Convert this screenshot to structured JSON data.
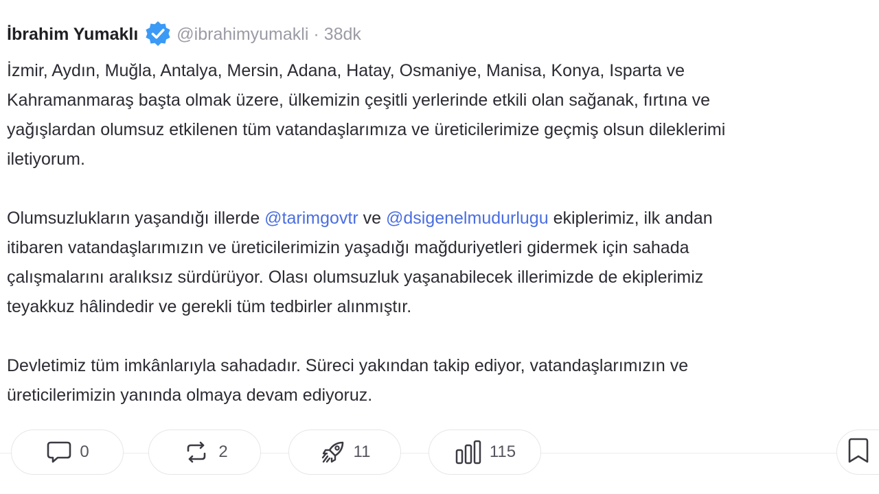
{
  "author": {
    "name": "İbrahim Yumaklı",
    "handle": "@ibrahimyumakli",
    "separator": "·",
    "time": "38dk",
    "verified_icon": "verified-badge-icon",
    "verified_color": "#3b9af5"
  },
  "post": {
    "paragraphs": [
      {
        "lines": [
          [
            {
              "text": "İzmir, Aydın, Muğla, Antalya, Mersin, Adana, Hatay, Osmaniye, Manisa, Konya, Isparta ve"
            }
          ],
          [
            {
              "text": "Kahramanmaraş başta olmak üzere, ülkemizin çeşitli yerlerinde etkili olan sağanak, fırtına ve"
            }
          ],
          [
            {
              "text": "yağışlardan olumsuz etkilenen tüm vatandaşlarımıza ve üreticilerimize geçmiş olsun dileklerimi"
            }
          ],
          [
            {
              "text": "iletiyorum."
            }
          ]
        ]
      },
      {
        "lines": [
          [
            {
              "text": "Olumsuzlukların yaşandığı illerde "
            },
            {
              "text": "@tarimgovtr",
              "mention": true
            },
            {
              "text": " ve "
            },
            {
              "text": "@dsigenelmudurlugu",
              "mention": true
            },
            {
              "text": " ekiplerimiz, ilk andan"
            }
          ],
          [
            {
              "text": "itibaren vatandaşlarımızın ve üreticilerimizin yaşadığı mağduriyetleri gidermek için sahada"
            }
          ],
          [
            {
              "text": "çalışmalarını aralıksız sürdürüyor. Olası olumsuzluk yaşanabilecek illerimizde de ekiplerimiz"
            }
          ],
          [
            {
              "text": "teyakkuz hâlindedir ve gerekli tüm tedbirler alınmıştır."
            }
          ]
        ]
      },
      {
        "lines": [
          [
            {
              "text": "Devletimiz tüm imkânlarıyla sahadadır. Süreci yakından takip ediyor, vatandaşlarımızın ve"
            }
          ],
          [
            {
              "text": "üreticilerimizin yanında olmaya devam ediyoruz."
            }
          ]
        ]
      }
    ],
    "mention_color": "#4a6ee0"
  },
  "actions": {
    "reply": {
      "icon": "reply-icon",
      "count": "0"
    },
    "repost": {
      "icon": "repost-icon",
      "count": "2"
    },
    "boost": {
      "icon": "rocket-icon",
      "count": "11"
    },
    "views": {
      "icon": "bar-chart-icon",
      "count": "115"
    },
    "bookmark": {
      "icon": "bookmark-icon"
    }
  }
}
